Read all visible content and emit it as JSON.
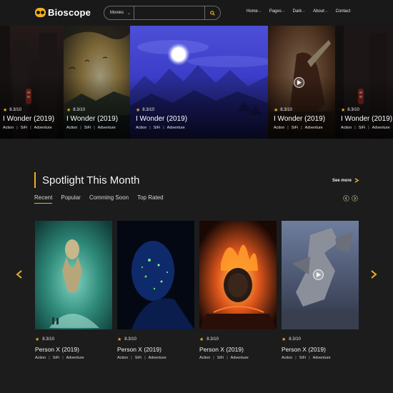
{
  "header": {
    "logo": "Bioscope",
    "search": {
      "category": "Movies",
      "placeholder": ""
    },
    "nav": [
      {
        "label": "Home",
        "has_menu": true
      },
      {
        "label": "Pages",
        "has_menu": true
      },
      {
        "label": "Dark",
        "has_menu": true
      },
      {
        "label": "About",
        "has_menu": true
      },
      {
        "label": "Contact",
        "has_menu": false
      }
    ]
  },
  "hero": {
    "slides": [
      {
        "rating": "8.3/10",
        "title": "I Wonder (2019)",
        "genres": [
          "Action",
          "SiFi",
          "Adventure"
        ]
      },
      {
        "rating": "8.3/10",
        "title": "I Wonder (2019)",
        "genres": [
          "Action",
          "SiFi",
          "Adventure"
        ]
      },
      {
        "rating": "8.3/10",
        "title": "I Wonder (2019)",
        "genres": [
          "Action",
          "SiFi",
          "Adventure"
        ]
      },
      {
        "rating": "8.3/10",
        "title": "I Wonder (2019)",
        "genres": [
          "Action",
          "SiFi",
          "Adventure"
        ]
      },
      {
        "rating": "8.3/10",
        "title": "I Wonder (2019)",
        "genres": [
          "Action",
          "SiFi",
          "Adventure"
        ]
      }
    ]
  },
  "spotlight": {
    "title": "Spotlight This Month",
    "see_more": "See more",
    "tabs": [
      "Recent",
      "Popular",
      "Comming Soon",
      "Top Rated"
    ],
    "active_tab": "Recent",
    "cards": [
      {
        "rating": "8.3/10",
        "title": "Person X (2019)",
        "genres": [
          "Action",
          "SiFi",
          "Adventure"
        ]
      },
      {
        "rating": "8.3/10",
        "title": "Person X (2019)",
        "genres": [
          "Action",
          "SiFi",
          "Adventure"
        ]
      },
      {
        "rating": "8.3/10",
        "title": "Person X (2019)",
        "genres": [
          "Action",
          "SiFi",
          "Adventure"
        ]
      },
      {
        "rating": "8.3/10",
        "title": "Person X (2019)",
        "genres": [
          "Action",
          "SiFi",
          "Adventure"
        ]
      }
    ]
  },
  "colors": {
    "background": "#1c1c1d",
    "header": "#19191a",
    "accent": "#f2b01e",
    "star": "#e6b422",
    "text": "#e6e6e6"
  }
}
